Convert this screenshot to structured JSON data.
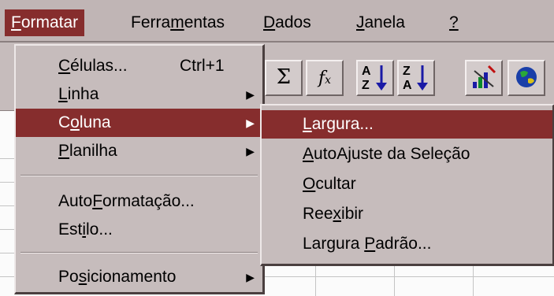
{
  "menubar": {
    "items": [
      {
        "pre": "",
        "u": "F",
        "post": "ormatar"
      },
      {
        "pre": "Ferra",
        "u": "m",
        "post": "entas"
      },
      {
        "pre": "",
        "u": "D",
        "post": "ados"
      },
      {
        "pre": "",
        "u": "J",
        "post": "anela"
      },
      {
        "pre": "",
        "u": "?",
        "post": ""
      }
    ]
  },
  "toolbar": {
    "buttons": [
      "autosum",
      "function-wizard",
      "sort-ascending",
      "sort-descending",
      "chart-wizard",
      "map"
    ]
  },
  "format_menu": {
    "items": [
      {
        "pre": "",
        "u": "C",
        "post": "élulas...",
        "shortcut": "Ctrl+1"
      },
      {
        "pre": "",
        "u": "L",
        "post": "inha",
        "arrow": "▶"
      },
      {
        "pre": "C",
        "u": "o",
        "post": "luna",
        "arrow": "▶"
      },
      {
        "pre": "",
        "u": "P",
        "post": "lanilha",
        "arrow": "▶"
      },
      {
        "pre": "Auto",
        "u": "F",
        "post": "ormatação..."
      },
      {
        "pre": "Est",
        "u": "i",
        "post": "lo..."
      },
      {
        "pre": "Po",
        "u": "s",
        "post": "icionamento",
        "arrow": "▶"
      }
    ]
  },
  "column_submenu": {
    "items": [
      {
        "pre": "",
        "u": "L",
        "post": "argura..."
      },
      {
        "pre": "",
        "u": "A",
        "post": "utoAjuste da Seleção"
      },
      {
        "pre": "",
        "u": "O",
        "post": "cultar"
      },
      {
        "pre": "Ree",
        "u": "x",
        "post": "ibir"
      },
      {
        "pre": "Largura ",
        "u": "P",
        "post": "adrão..."
      }
    ]
  },
  "colors": {
    "highlight": "#862d2d",
    "menu_face": "#c6bcbc"
  }
}
